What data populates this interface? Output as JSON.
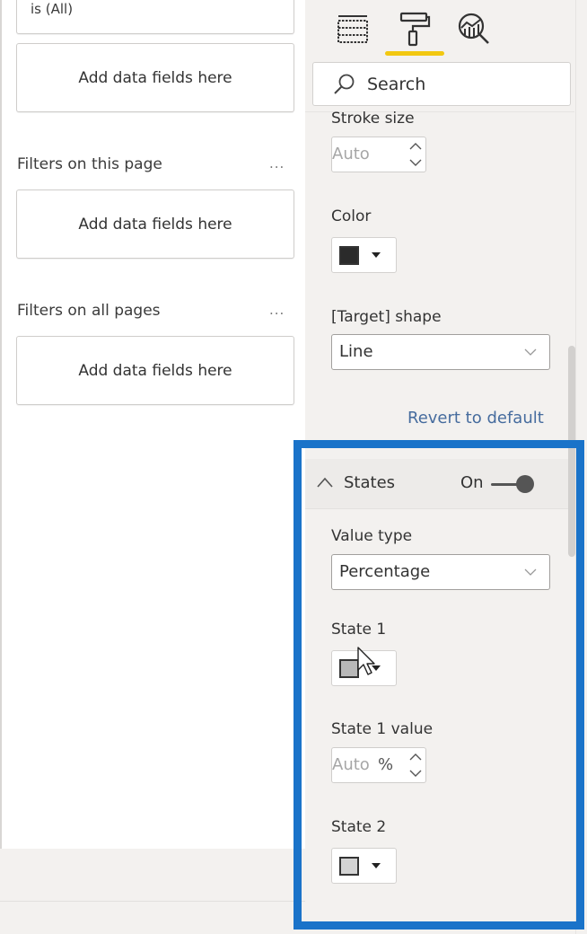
{
  "filters_pane": {
    "top_filter_value": "is (All)",
    "visual_drop_placeholder": "Add data fields here",
    "sections": [
      {
        "label": "Filters on this page",
        "more": "...",
        "placeholder": "Add data fields here"
      },
      {
        "label": "Filters on all pages",
        "more": "...",
        "placeholder": "Add data fields here"
      }
    ]
  },
  "format_pane": {
    "tabs": [
      {
        "name": "fields",
        "icon": "fields-icon",
        "active": false
      },
      {
        "name": "format",
        "icon": "paint-roller-icon",
        "active": true
      },
      {
        "name": "analytics",
        "icon": "analytics-icon",
        "active": false
      }
    ],
    "active_tab_color": "#f2c811",
    "search": {
      "placeholder": "Search",
      "value": ""
    },
    "stroke_size": {
      "label": "Stroke size",
      "value": "Auto"
    },
    "color": {
      "label": "Color",
      "swatch": "#2b2b2b"
    },
    "target_shape": {
      "label": "[Target] shape",
      "value": "Line"
    },
    "revert_label": "Revert to default",
    "states": {
      "title": "States",
      "toggle_label": "On",
      "toggle_on": true,
      "value_type": {
        "label": "Value type",
        "value": "Percentage"
      },
      "state1": {
        "label": "State 1",
        "swatch": "#b8b8b8"
      },
      "state1_value": {
        "label": "State 1 value",
        "value": "Auto",
        "unit": "%"
      },
      "state2": {
        "label": "State 2",
        "swatch": "#d3d3d3"
      }
    },
    "highlight_color": "#1a73c9"
  }
}
